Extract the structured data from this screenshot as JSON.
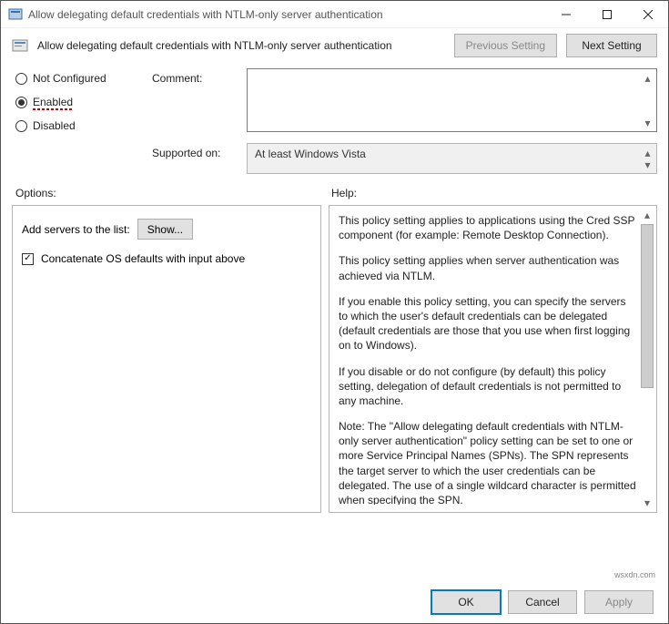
{
  "titlebar": {
    "title": "Allow delegating default credentials with NTLM-only server authentication"
  },
  "header": {
    "title": "Allow delegating default credentials with NTLM-only server authentication",
    "prev_label": "Previous Setting",
    "next_label": "Next Setting"
  },
  "radios": {
    "not_configured": "Not Configured",
    "enabled": "Enabled",
    "disabled": "Disabled",
    "selected": "enabled"
  },
  "fields": {
    "comment_label": "Comment:",
    "comment_value": "",
    "supported_label": "Supported on:",
    "supported_value": "At least Windows Vista"
  },
  "sections": {
    "options": "Options:",
    "help": "Help:"
  },
  "options": {
    "add_servers_label": "Add servers to the list:",
    "show_label": "Show...",
    "concat_label": "Concatenate OS defaults with input above",
    "concat_checked": true
  },
  "help": {
    "p1": "This policy setting applies to applications using the Cred SSP component (for example: Remote Desktop Connection).",
    "p2": "This policy setting applies when server authentication was achieved via NTLM.",
    "p3": "If you enable this policy setting, you can specify the servers to which the user's default credentials can be delegated (default credentials are those that you use when first logging on to Windows).",
    "p4": "If you disable or do not configure (by default) this policy setting, delegation of default credentials is not permitted to any machine.",
    "p5": "Note: The \"Allow delegating default credentials with NTLM-only server authentication\" policy setting can be set to one or more Service Principal Names (SPNs). The SPN represents the target server to which the user credentials can be delegated.  The use of a single wildcard character is permitted when specifying the SPN."
  },
  "footer": {
    "ok": "OK",
    "cancel": "Cancel",
    "apply": "Apply"
  },
  "watermark": "wsxdn.com"
}
